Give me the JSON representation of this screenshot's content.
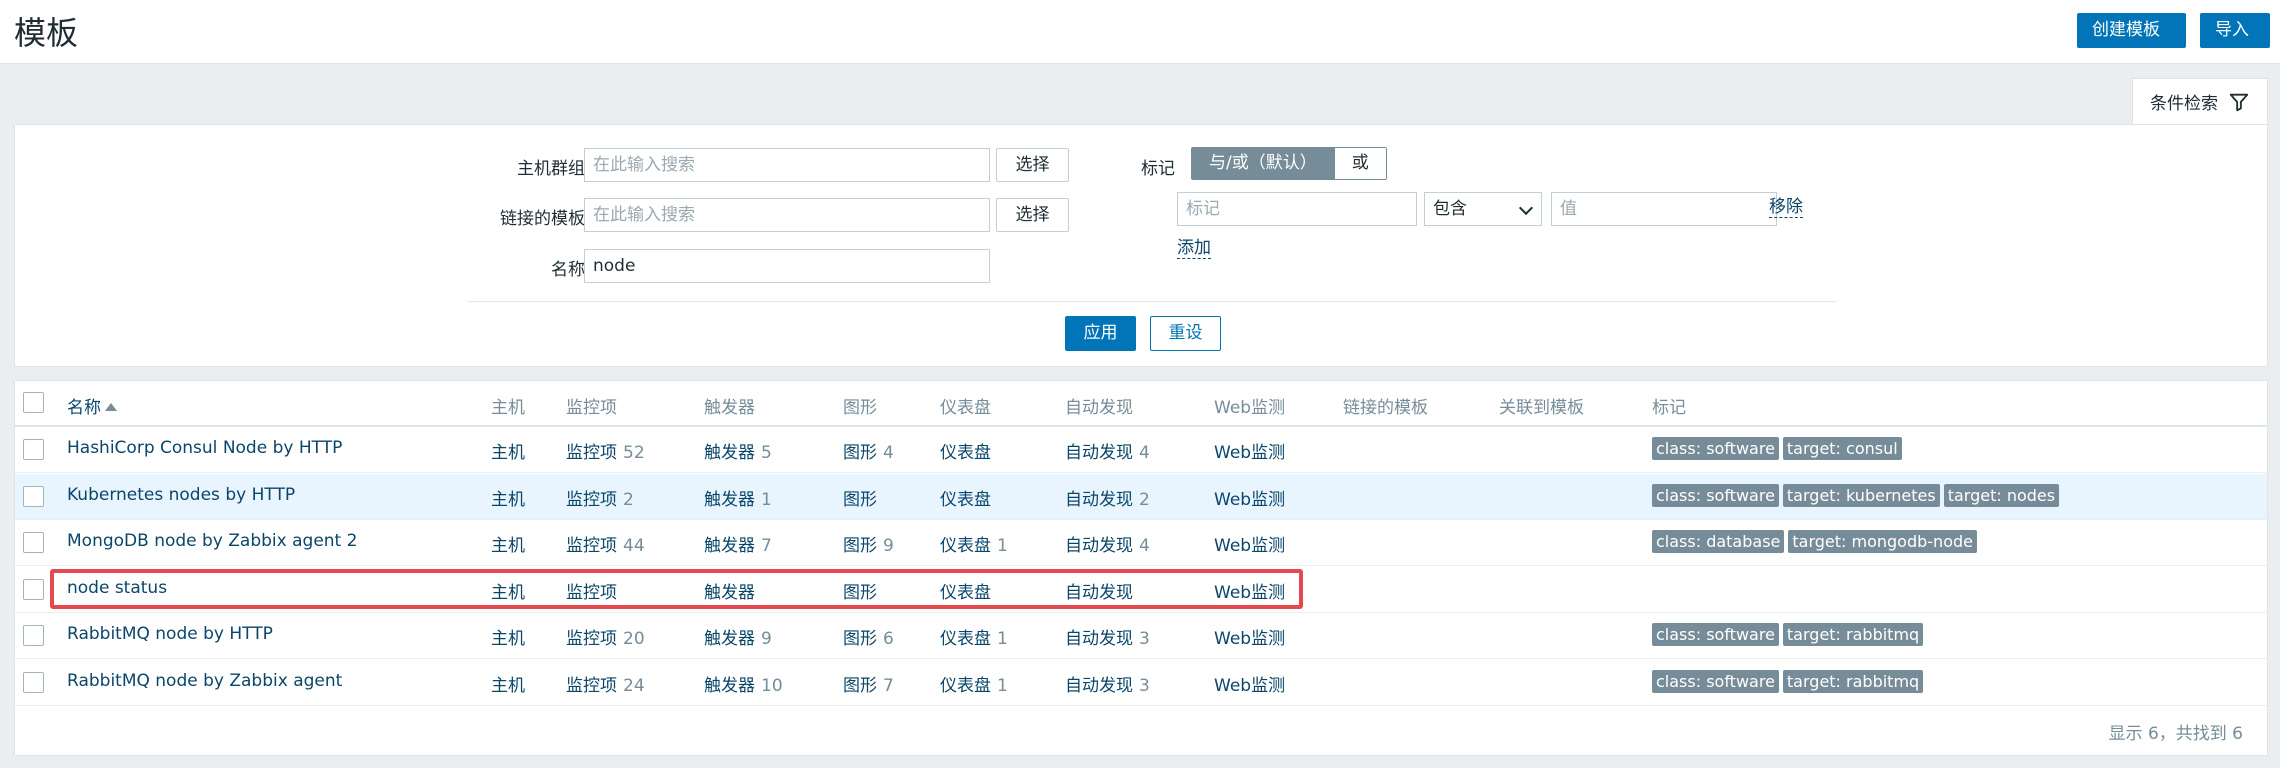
{
  "header": {
    "title": "模板",
    "create_button": "创建模板",
    "import_button": "导入"
  },
  "filter": {
    "tab_label": "条件检索",
    "host_group": {
      "label": "主机群组",
      "placeholder": "在此输入搜索",
      "select": "选择"
    },
    "linked_templates": {
      "label": "链接的模板",
      "placeholder": "在此输入搜索",
      "select": "选择"
    },
    "name": {
      "label": "名称",
      "value": "node"
    },
    "tags": {
      "label": "标记",
      "mode_and_or": "与/或（默认）",
      "mode_or": "或",
      "tag_placeholder": "标记",
      "operator": "包含",
      "value_placeholder": "值",
      "remove": "移除",
      "add": "添加"
    },
    "apply": "应用",
    "reset": "重设"
  },
  "table": {
    "columns": {
      "name": "名称",
      "hosts": "主机",
      "items": "监控项",
      "triggers": "触发器",
      "graphs": "图形",
      "dashboards": "仪表盘",
      "discovery": "自动发现",
      "web": "Web监测",
      "linked": "链接的模板",
      "linked_to": "关联到模板",
      "tags": "标记"
    },
    "rows": [
      {
        "name": "HashiCorp Consul Node by HTTP",
        "hosts": "主机",
        "items": "监控项",
        "items_n": "52",
        "triggers": "触发器",
        "triggers_n": "5",
        "graphs": "图形",
        "graphs_n": "4",
        "dashboards": "仪表盘",
        "dashboards_n": "",
        "discovery": "自动发现",
        "discovery_n": "4",
        "web": "Web监测",
        "tags": [
          "class: software",
          "target: consul"
        ]
      },
      {
        "name": "Kubernetes nodes by HTTP",
        "hosts": "主机",
        "items": "监控项",
        "items_n": "2",
        "triggers": "触发器",
        "triggers_n": "1",
        "graphs": "图形",
        "graphs_n": "",
        "dashboards": "仪表盘",
        "dashboards_n": "",
        "discovery": "自动发现",
        "discovery_n": "2",
        "web": "Web监测",
        "tags": [
          "class: software",
          "target: kubernetes",
          "target: nodes"
        ]
      },
      {
        "name": "MongoDB node by Zabbix agent 2",
        "hosts": "主机",
        "items": "监控项",
        "items_n": "44",
        "triggers": "触发器",
        "triggers_n": "7",
        "graphs": "图形",
        "graphs_n": "9",
        "dashboards": "仪表盘",
        "dashboards_n": "1",
        "discovery": "自动发现",
        "discovery_n": "4",
        "web": "Web监测",
        "tags": [
          "class: database",
          "target: mongodb-node"
        ]
      },
      {
        "name": "node status",
        "hosts": "主机",
        "items": "监控项",
        "items_n": "",
        "triggers": "触发器",
        "triggers_n": "",
        "graphs": "图形",
        "graphs_n": "",
        "dashboards": "仪表盘",
        "dashboards_n": "",
        "discovery": "自动发现",
        "discovery_n": "",
        "web": "Web监测",
        "tags": []
      },
      {
        "name": "RabbitMQ node by HTTP",
        "hosts": "主机",
        "items": "监控项",
        "items_n": "20",
        "triggers": "触发器",
        "triggers_n": "9",
        "graphs": "图形",
        "graphs_n": "6",
        "dashboards": "仪表盘",
        "dashboards_n": "1",
        "discovery": "自动发现",
        "discovery_n": "3",
        "web": "Web监测",
        "tags": [
          "class: software",
          "target: rabbitmq"
        ]
      },
      {
        "name": "RabbitMQ node by Zabbix agent",
        "hosts": "主机",
        "items": "监控项",
        "items_n": "24",
        "triggers": "触发器",
        "triggers_n": "10",
        "graphs": "图形",
        "graphs_n": "7",
        "dashboards": "仪表盘",
        "dashboards_n": "1",
        "discovery": "自动发现",
        "discovery_n": "3",
        "web": "Web监测",
        "tags": [
          "class: software",
          "target: rabbitmq"
        ]
      }
    ],
    "footer": "显示 6，共找到 6"
  },
  "colors": {
    "primary": "#0275b8",
    "link": "#0a466a",
    "tag_bg": "#768d99",
    "highlight": "#e5484d",
    "row_hover": "#e8f5ff"
  }
}
